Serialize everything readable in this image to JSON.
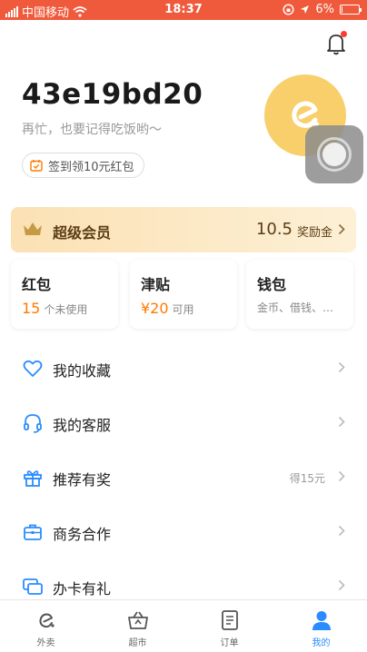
{
  "status_bar": {
    "carrier": "中国移动",
    "time": "18:37",
    "battery_text": "6%",
    "battery_level": 0.06
  },
  "profile": {
    "username": "43e19bd20",
    "subtitle": "再忙，也要记得吃饭哟～",
    "checkin_label": "签到领10元红包"
  },
  "vip": {
    "title": "超级会员",
    "amount": "10.5",
    "unit": "奖励金"
  },
  "cards": [
    {
      "title": "红包",
      "number": "15",
      "suffix": "个未使用"
    },
    {
      "title": "津贴",
      "number": "¥20",
      "suffix": "可用"
    },
    {
      "title": "钱包",
      "number": "",
      "suffix": "金币、借钱、…"
    }
  ],
  "menu": [
    {
      "label": "我的收藏",
      "extra": "",
      "icon": "heart-icon"
    },
    {
      "label": "我的客服",
      "extra": "",
      "icon": "headset-icon"
    },
    {
      "label": "推荐有奖",
      "extra": "得15元",
      "icon": "gift-icon"
    },
    {
      "label": "商务合作",
      "extra": "",
      "icon": "briefcase-icon"
    },
    {
      "label": "办卡有礼",
      "extra": "",
      "icon": "cards-icon"
    }
  ],
  "tabs": [
    {
      "label": "外卖",
      "icon": "eleme-icon"
    },
    {
      "label": "超市",
      "icon": "basket-icon"
    },
    {
      "label": "订单",
      "icon": "order-icon"
    },
    {
      "label": "我的",
      "icon": "person-icon"
    }
  ],
  "colors": {
    "status_bar": "#f05a3c",
    "accent_orange": "#ff7a00",
    "active_tab": "#2a8cff",
    "menu_icon": "#2a8cff"
  }
}
